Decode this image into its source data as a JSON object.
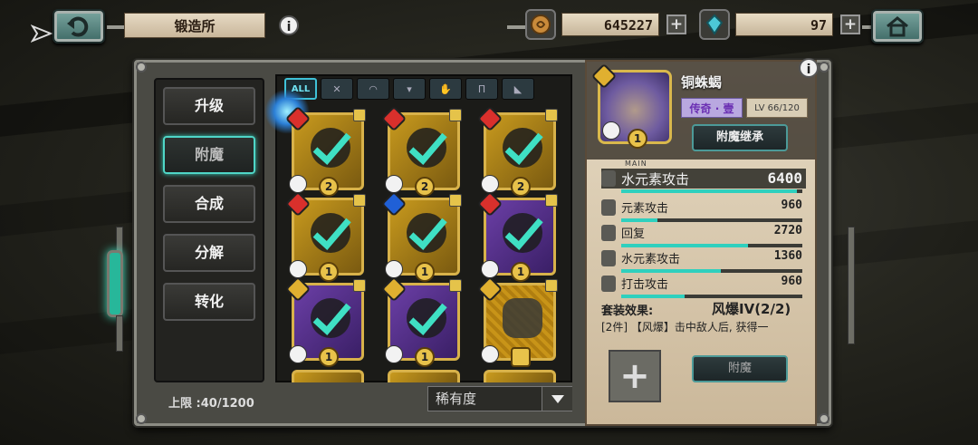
{
  "header": {
    "title": "锻造所",
    "gold_amount": "645227",
    "crystal_amount": "97"
  },
  "side_menu": {
    "items": [
      {
        "label": "升级",
        "active": false
      },
      {
        "label": "附魔",
        "active": true
      },
      {
        "label": "合成",
        "active": false
      },
      {
        "label": "分解",
        "active": false
      },
      {
        "label": "转化",
        "active": false
      }
    ]
  },
  "filter_tabs": [
    {
      "label": "ALL",
      "active": true
    },
    {
      "icon": "sword-icon"
    },
    {
      "icon": "helmet-icon"
    },
    {
      "icon": "armor-icon"
    },
    {
      "icon": "glove-icon"
    },
    {
      "icon": "pants-icon"
    },
    {
      "icon": "boots-icon"
    }
  ],
  "grid": {
    "capacity_label": "上限 :40/1200",
    "sort_label": "稀有度",
    "cards": [
      {
        "rarity": "gold",
        "element": "fire",
        "level": "2",
        "checked": true,
        "locked": true
      },
      {
        "rarity": "gold",
        "element": "fire",
        "level": "2",
        "checked": true,
        "locked": true
      },
      {
        "rarity": "gold",
        "element": "fire",
        "level": "2",
        "checked": true,
        "locked": true
      },
      {
        "rarity": "gold",
        "element": "fire",
        "level": "1",
        "checked": true,
        "locked": true
      },
      {
        "rarity": "gold",
        "element": "water",
        "level": "1",
        "checked": true,
        "locked": true
      },
      {
        "rarity": "purple",
        "element": "fire",
        "level": "1",
        "checked": true,
        "locked": true
      },
      {
        "rarity": "purple",
        "element": "gold",
        "level": "1",
        "checked": true,
        "locked": true
      },
      {
        "rarity": "purple",
        "element": "gold",
        "level": "1",
        "checked": true,
        "locked": true
      },
      {
        "rarity": "gold",
        "element": "gold",
        "level": "",
        "checked": false,
        "locked": true
      }
    ]
  },
  "detail": {
    "item_name": "铜蛛蝎",
    "rarity_label": "传奇 · 壹",
    "level_label": "LV 66/120",
    "portrait_level": "1",
    "inherit_button": "附魔继承",
    "main_tag": "MAIN",
    "stats": [
      {
        "name": "水元素攻击",
        "value": "6400",
        "main": true,
        "fill": 0.97
      },
      {
        "name": "元素攻击",
        "value": "960",
        "main": false,
        "fill": 0.2
      },
      {
        "name": "回复",
        "value": "2720",
        "main": false,
        "fill": 0.7
      },
      {
        "name": "水元素攻击",
        "value": "1360",
        "main": false,
        "fill": 0.55
      },
      {
        "name": "打击攻击",
        "value": "960",
        "main": false,
        "fill": 0.35
      }
    ],
    "set_label": "套装效果:",
    "set_value": "风爆IV(2/2)",
    "set_desc": "[2件] 【风爆】击中敌人后, 获得一",
    "enchant_button": "附魔"
  },
  "colors": {
    "accent_teal": "#2fd0be",
    "gold_card": "#c89a1e",
    "purple_card": "#6b3fa6",
    "rarity_text": "#6b2fb3"
  }
}
